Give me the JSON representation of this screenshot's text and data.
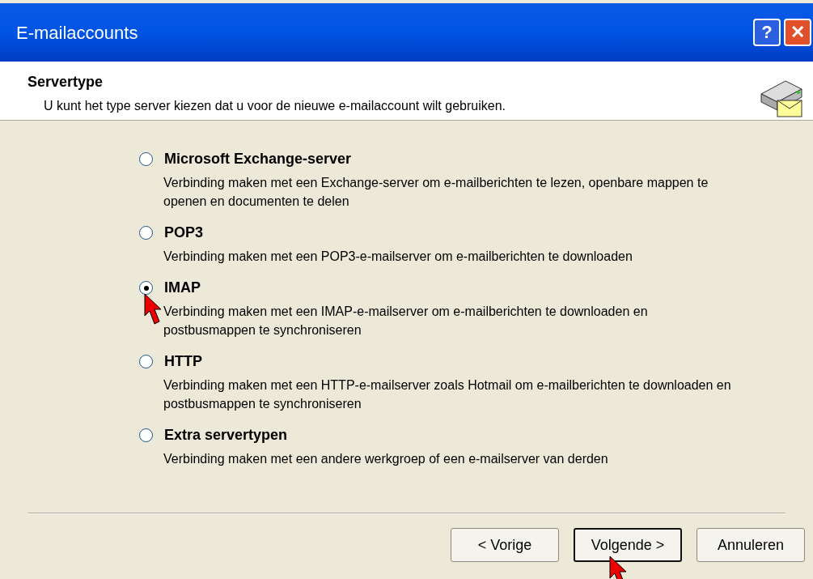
{
  "window": {
    "title": "E-mailaccounts"
  },
  "title_buttons": [
    {
      "kind": "help",
      "label": "?"
    },
    {
      "kind": "close",
      "label": "✕"
    }
  ],
  "header": {
    "title": "Servertype",
    "subtitle": "U kunt het type server kiezen dat u voor de nieuwe e-mailaccount wilt gebruiken."
  },
  "options": [
    {
      "label": "Microsoft Exchange-server",
      "description": "Verbinding maken met een Exchange-server om e-mailberichten te lezen, openbare mappen te openen en documenten te delen",
      "selected": false,
      "cursor": false
    },
    {
      "label": "POP3",
      "description": "Verbinding maken met een POP3-e-mailserver om e-mailberichten te downloaden",
      "selected": false,
      "cursor": false
    },
    {
      "label": "IMAP",
      "description": "Verbinding maken met een IMAP-e-mailserver om e-mailberichten te downloaden en postbusmappen te synchroniseren",
      "selected": true,
      "cursor": true
    },
    {
      "label": "HTTP",
      "description": "Verbinding maken met een HTTP-e-mailserver zoals Hotmail om e-mailberichten te downloaden en postbusmappen te synchroniseren",
      "selected": false,
      "cursor": false
    },
    {
      "label": "Extra servertypen",
      "description": "Verbinding maken met een andere werkgroep of een e-mailserver van derden",
      "selected": false,
      "cursor": false
    }
  ],
  "buttons": [
    {
      "label": "< Vorige",
      "default": false,
      "cursor": false
    },
    {
      "label": "Volgende >",
      "default": true,
      "cursor": true
    },
    {
      "label": "Annuleren",
      "default": false,
      "cursor": false
    }
  ]
}
